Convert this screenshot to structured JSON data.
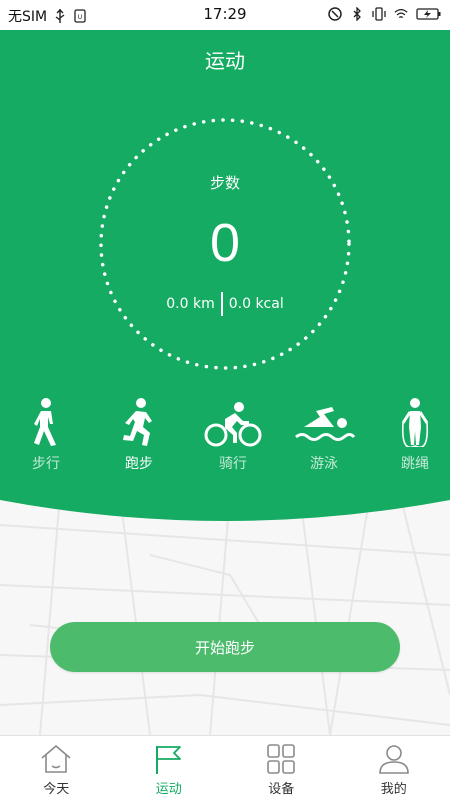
{
  "status_bar": {
    "carrier": "无SIM",
    "time": "17:29",
    "battery_icon": "battery-charging-icon"
  },
  "header": {
    "title": "运动"
  },
  "summary": {
    "steps_label": "步数",
    "steps_value": "0",
    "distance": "0.0 km",
    "calories": "0.0 kcal"
  },
  "modes": [
    {
      "label": "步行",
      "icon": "walking-icon",
      "active": false
    },
    {
      "label": "跑步",
      "icon": "running-icon",
      "active": true
    },
    {
      "label": "骑行",
      "icon": "cycling-icon",
      "active": false
    },
    {
      "label": "游泳",
      "icon": "swimming-icon",
      "active": false
    },
    {
      "label": "跳绳",
      "icon": "jump-rope-icon",
      "active": false
    }
  ],
  "start_button": {
    "label": "开始跑步"
  },
  "tabbar": {
    "items": [
      {
        "label": "今天",
        "icon": "home-icon",
        "active": false
      },
      {
        "label": "运动",
        "icon": "flag-icon",
        "active": true
      },
      {
        "label": "设备",
        "icon": "grid-icon",
        "active": false
      },
      {
        "label": "我的",
        "icon": "user-icon",
        "active": false
      }
    ]
  },
  "colors": {
    "primary": "#15ab62",
    "button": "#4dbb6c",
    "tab_active": "#15ab62"
  }
}
